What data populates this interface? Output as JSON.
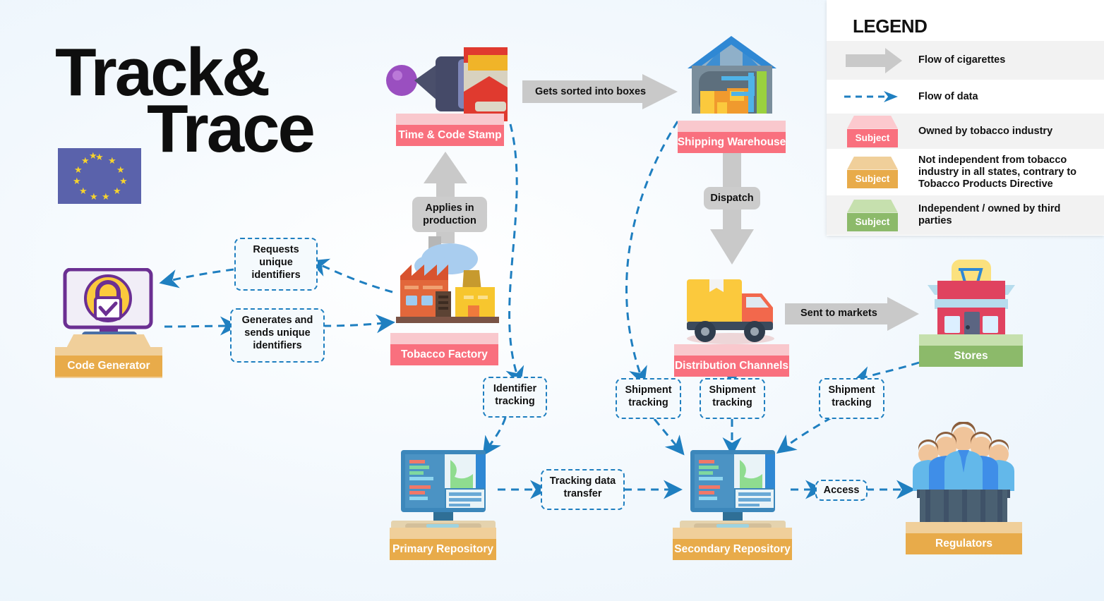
{
  "logo": {
    "line1": "Track&",
    "line2": "Trace",
    "flag": "eu-flag"
  },
  "legend": {
    "title": "LEGEND",
    "rows": [
      {
        "key": "gray-arrow",
        "text": "Flow of cigarettes"
      },
      {
        "key": "dashed-arrow",
        "text": "Flow of data"
      },
      {
        "key": "swatch-pink",
        "chip": "Subject",
        "text": "Owned by tobacco industry"
      },
      {
        "key": "swatch-orange",
        "chip": "Subject",
        "text": "Not independent from tobacco industry in all states, contrary to Tobacco Products Directive"
      },
      {
        "key": "swatch-green",
        "chip": "Subject",
        "text": "Independent / owned by third parties"
      }
    ]
  },
  "nodes": [
    {
      "id": "code-generator",
      "label": "Code Generator",
      "color": "orange"
    },
    {
      "id": "time-code-stamp",
      "label": "Time & Code Stamp",
      "color": "pink"
    },
    {
      "id": "tobacco-factory",
      "label": "Tobacco Factory",
      "color": "pink"
    },
    {
      "id": "shipping-warehouse",
      "label": "Shipping Warehouse",
      "color": "pink"
    },
    {
      "id": "distribution-channels",
      "label": "Distribution Channels",
      "color": "pink"
    },
    {
      "id": "stores",
      "label": "Stores",
      "color": "green"
    },
    {
      "id": "primary-repository",
      "label": "Primary Repository",
      "color": "orange"
    },
    {
      "id": "secondary-repository",
      "label": "Secondary Repository",
      "color": "orange"
    },
    {
      "id": "regulators",
      "label": "Regulators",
      "color": "orange"
    }
  ],
  "flow_labels": {
    "gets_sorted": "Gets sorted into boxes",
    "applies_in_production": "Applies in production",
    "dispatch": "Dispatch",
    "sent_to_markets": "Sent to markets"
  },
  "data_labels": {
    "requests": "Requests unique identifiers",
    "generates": "Generates and sends unique identifiers",
    "identifier_tracking": "Identifier tracking",
    "shipment_tracking_1": "Shipment tracking",
    "shipment_tracking_2": "Shipment tracking",
    "shipment_tracking_3": "Shipment tracking",
    "tracking_data_transfer": "Tracking data transfer",
    "access": "Access"
  },
  "colors": {
    "pink_label": "#f9707e",
    "orange_label": "#e8ab4a",
    "green_label": "#8cba6a",
    "data_blue": "#1f7fc0",
    "flow_gray": "#c9c9c9",
    "background": "#eaf4fc"
  }
}
